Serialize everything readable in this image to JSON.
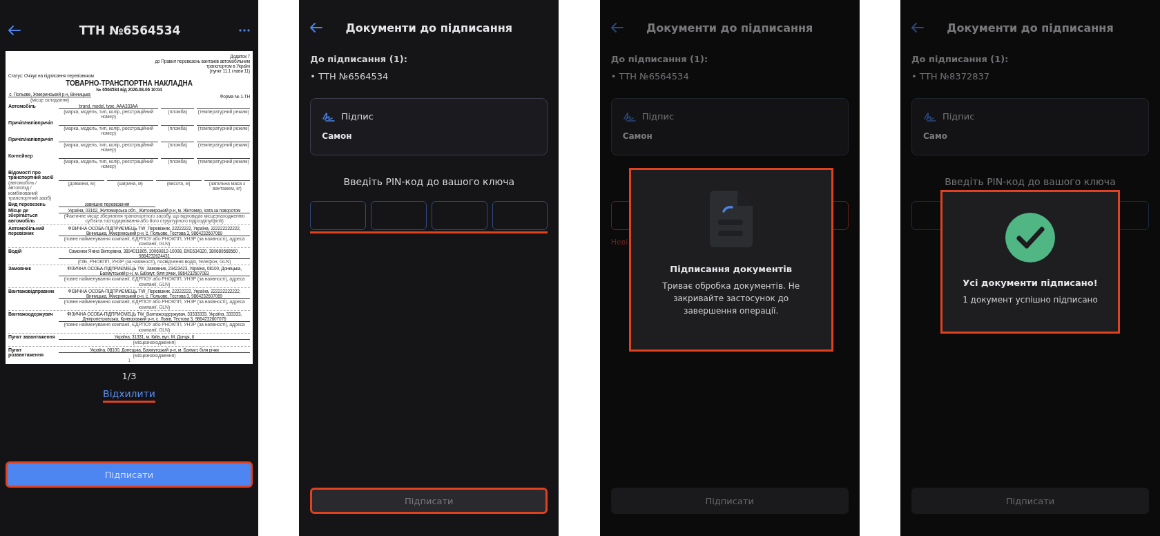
{
  "screens": [
    {
      "kind": "document_preview",
      "title": "ТТН №6564534",
      "document": {
        "appendix_lines": [
          "Додаток 7",
          "до Правил перевезень вантажів автомобільним",
          "транспортом в Україні",
          "(пункт 11.1 глави 11)"
        ],
        "status": "Статус: Очікує на підписання перевізником",
        "heading": "ТОВАРНО-ТРАНСПОРТНА НАКЛАДНА",
        "number": "№ 6564534 від 2026-08-06 10:04",
        "place": "с. Польове, Жмеринський р-н, Вінницька",
        "place_caption": "(місце складання)",
        "form": "Форма № 1-ТН",
        "rows": [
          {
            "kind": "vehicle",
            "label": "Автомобіль",
            "value": "brand, model, type, AAA333AA",
            "captions": [
              "(марка, модель, тип, колір, реєстраційний номер)",
              "(пломба)",
              "(температурний режим)"
            ]
          },
          {
            "kind": "vehicle",
            "label": "Причіп/напівпричіп",
            "captions": [
              "(марка, модель, тип, колір, реєстраційний номер)",
              "(пломба)",
              "(температурний режим)"
            ]
          },
          {
            "kind": "vehicle",
            "label": "Причіп/напівпричіп",
            "captions": [
              "(марка, модель, тип, колір, реєстраційний номер)",
              "(пломба)",
              "(температурний режим)"
            ]
          },
          {
            "kind": "vehicle",
            "label": "Контейнер",
            "captions": [
              "(марка, модель, тип, колір, реєстраційний номер)",
              "(пломба)",
              "(температурний режим)"
            ]
          },
          {
            "kind": "dims",
            "label": "Відомості про транспортний засіб",
            "sublabel": "(автомобіль / автопоїзд / комбінований транспортний засіб)",
            "captions": [
              "(довжина, м)",
              "(ширина, м)",
              "(висота, м)",
              "(загальна маса з вантажем, кг)"
            ]
          },
          {
            "kind": "short",
            "label": "Вид перевезень",
            "value": "зовнішнє перевезення"
          },
          {
            "kind": "value",
            "label": "Місце де зберігається автомобіль",
            "value": "Україна, 03162, Житомирська обл., Житомирський р-н, м. Житомир, хата за поворотом",
            "caption": "(Фактичне місце зберігання транспортного засобу, що відповідає місцезнаходженню суб'єкта господарювання або його структурного підрозділу/філії)"
          },
          {
            "kind": "value",
            "label": "Автомобільний перевізник",
            "value": "ФІЗИЧНА ОСОБА-ПІДПРИЄМЕЦЬ TW_Перевізник, 22222222, Україна, 222222222222, Вінницька, Жмеринський р-н, с. Польове, Тестова 3, 9864232607069",
            "caption": "(повне найменування компанії, ЄДРПОУ або РНОКПП, УНЗР (за наявності), адреса компанії, GLN)"
          },
          {
            "kind": "value",
            "label": "Водій",
            "value": "Самонюк Яніна Вікторівна, 3894011805, 20060812-10008, ВХЕ634320, 380689568560 , 9864232624431",
            "caption": "(ПІБ, РНОКПП, УНЗР (за наявності), посвідчення водія, телефон, GLN)"
          },
          {
            "kind": "value",
            "label": "Замовник",
            "value": "ФІЗИЧНА ОСОБА-ПІДПРИЄМЕЦЬ TW_Замовник, 23423423, Україна, 08100, Донецька, Бахмутський р-н, м. Бахмут, біля річки, 9864232607083",
            "caption": "(повне найменування компанії, ЄДРПОУ або РНОКПП, УНЗР (за наявності), адреса компанії, GLN)"
          },
          {
            "kind": "value",
            "label": "Вантажовідправник",
            "value": "ФІЗИЧНА ОСОБА-ПІДПРИЄМЕЦЬ TW_Перевізник, 22222222, Україна, 222222222222, Вінницька, Жмеринський р-н, с. Польове, Тестова 3, 9864232607069",
            "caption": "(повне найменування компанії, ЄДРПОУ або РНОКПП, УНЗР (за наявності), адреса компанії, GLN)"
          },
          {
            "kind": "value",
            "label": "Вантажоодержувач",
            "value": "ФІЗИЧНА ОСОБА-ПІДПРИЄМЕЦЬ TW_Вантажоодержувач, 33333333, Україна, 333333, Дніпропетровська, Криворізький р-н, с. Львів, Тестова 3, 9864232607076",
            "caption": "(повне найменування компанії, ЄДРПОУ або РНОКПП, УНЗР (за наявності), адреса компанії, GLN)"
          },
          {
            "kind": "value",
            "label": "Пункт завантаження",
            "value": "Україна, 31331, м. Київ, вул. М. Донця, 6",
            "caption": "(місцезнаходження)"
          },
          {
            "kind": "value",
            "label": "Пункт розвантаження",
            "value": "Україна, 08100, Донецька, Бахмутський р-н, м. Бахмут, біля річки",
            "caption": "(місцезнаходження)"
          }
        ],
        "page_number": "1"
      },
      "page_indicator": "1/3",
      "reject_link": {
        "label": "Відхилити",
        "highlighted": true
      },
      "sign_button": {
        "label": "Підписати",
        "disabled": false,
        "highlighted": true
      }
    },
    {
      "kind": "signing",
      "dimmed": false,
      "title": "Документи до підписання",
      "pending_label": "До підписання (1):",
      "documents": [
        "• ТТН №6564534"
      ],
      "signature": {
        "label": "Підпис",
        "name": "Самон"
      },
      "pin_prompt": "Введіть PIN-код до вашого ключа",
      "pin_error": false,
      "pin_highlighted": true,
      "sign_button": {
        "label": "Підписати",
        "disabled": true,
        "highlighted": true
      }
    },
    {
      "kind": "signing",
      "dimmed": true,
      "title": "Документи до підписання",
      "pending_label": "До підписання (1):",
      "documents": [
        "• ТТН №6564534"
      ],
      "signature": {
        "label": "Підпис",
        "name": "Самон"
      },
      "pin_error": true,
      "pin_highlighted": false,
      "error_text": "Неві",
      "sign_button": {
        "label": "Підписати",
        "disabled": true,
        "highlighted": false
      },
      "modal": {
        "kind": "progress",
        "title": "Підписання документів",
        "message": "Триває обробка документів. Не закривайте застосунок до завершення операції.",
        "highlighted": true
      }
    },
    {
      "kind": "signing",
      "dimmed": true,
      "title": "Документи до підписання",
      "pending_label": "До підписання (1):",
      "documents": [
        "• ТТН №8372837"
      ],
      "signature": {
        "label": "Підпис",
        "name": "Само"
      },
      "pin_prompt": "Введіть PIN-код до вашого ключа",
      "pin_error": false,
      "pin_highlighted": false,
      "sign_button": {
        "label": "Підписати",
        "disabled": true,
        "highlighted": false
      },
      "modal": {
        "kind": "success",
        "title": "Усі документи підписано!",
        "message": "1 документ успішно підписано",
        "highlighted": true
      }
    }
  ]
}
